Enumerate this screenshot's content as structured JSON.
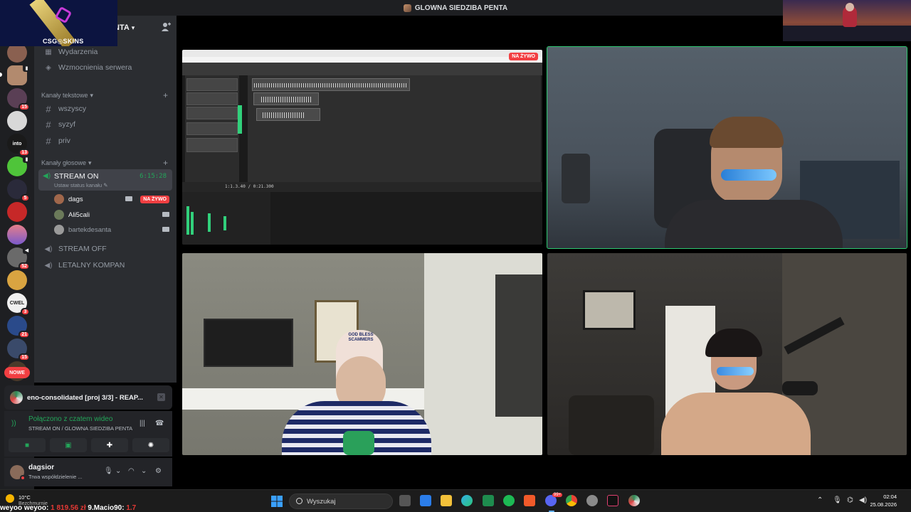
{
  "window": {
    "title": "GLOWNA SIEDZIBA PENTA"
  },
  "overlay": {
    "logo_text": "CSG◎SKINS"
  },
  "server": {
    "name": "NTA",
    "menu": [
      {
        "label": "Wydarzenia",
        "icon": "calendar-icon"
      },
      {
        "label": "Wzmocnienia serwera",
        "icon": "boost-icon"
      }
    ],
    "text_category": "Kanały tekstowe",
    "text_channels": [
      "wszyscy",
      "syzyf",
      "priv"
    ],
    "voice_category": "Kanały głosowe",
    "active_voice": {
      "name": "STREAM ON",
      "timer": "6:15:28",
      "status_placeholder": "Ustaw status kanału"
    },
    "voice_users": [
      {
        "name": "dags",
        "live": "NA ŻYWO",
        "color": "#a0674b"
      },
      {
        "name": "Ali5cali",
        "live": "",
        "color": "#6b7a5a"
      },
      {
        "name": "bartekdesanta",
        "live": "",
        "color": "#9a9a9a"
      }
    ],
    "other_voice": [
      "STREAM OFF",
      "LETALNY KOMPAN"
    ]
  },
  "rail": {
    "badges": [
      "15",
      "13",
      "5",
      "52",
      "3",
      "21",
      "15"
    ],
    "labels": [
      "into",
      "CWEL"
    ],
    "new_label": "NOWE"
  },
  "activity": {
    "title": "eno-consolidated [proj 3/3] - REAP..."
  },
  "voice_panel": {
    "connected": "Połączono z czatem wideo",
    "location": "STREAM ON / GLOWNA SIEDZIBA PENTA"
  },
  "user": {
    "name": "dagsior",
    "status": "Trwa współdzielenie ..."
  },
  "stage": {
    "live_badge": "NA ŻYWO",
    "daw_time": "1:1.3.40 / 0:21.300",
    "hat_text": "GOD BLESS SCAMMERS"
  },
  "taskbar": {
    "temp": "10°C",
    "condition": "Bezchmurnie",
    "ticker_name1": "weyoo weyoo:",
    "ticker_amount1": "1 819.56 zł",
    "ticker_name2": "9.Macio90:",
    "ticker_amount2": "1.7",
    "search": "Wyszukaj",
    "time": "02:04",
    "date": "25.08.2026",
    "discord_badge": "99+"
  },
  "colors": {
    "accent_green": "#23a559",
    "live_red": "#f23f42",
    "sidebar": "#2b2d31",
    "rail": "#1e1f22"
  }
}
